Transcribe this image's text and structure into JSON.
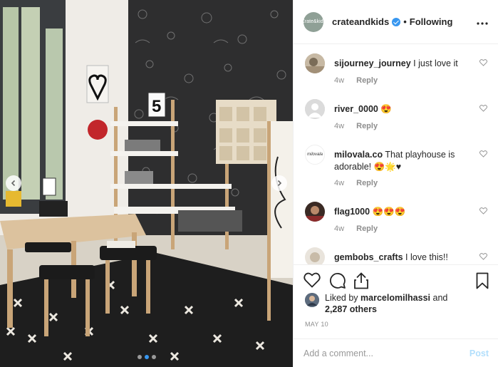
{
  "post": {
    "account": {
      "logo_text": "Crate&kids",
      "username": "crateandkids",
      "separator": "•",
      "follow_status": "Following",
      "more_icon": "more-horizontal-icon"
    },
    "comments": [
      {
        "username": "sijourney_journey",
        "text": "I just love it",
        "age": "4w",
        "reply_label": "Reply"
      },
      {
        "username": "river_0000",
        "text": "😍",
        "age": "4w",
        "reply_label": "Reply"
      },
      {
        "username": "milovala.co",
        "text": "That playhouse is adorable! 😍🌟♥",
        "age": "4w",
        "reply_label": "Reply",
        "avatar_text": "milovala"
      },
      {
        "username": "flag1000",
        "text": "😍😍😍",
        "age": "4w",
        "reply_label": "Reply"
      },
      {
        "username": "gembobs_crafts",
        "text": "I love this!! Xxxx",
        "age": "",
        "reply_label": ""
      }
    ],
    "likes": {
      "prefix": "Liked by",
      "user": "marcelomilhassi",
      "joiner": "and",
      "count": "2,287 others"
    },
    "date": "MAY 10",
    "add_comment": {
      "placeholder": "Add a comment...",
      "post_label": "Post"
    },
    "photo": {
      "card_number": "5",
      "carousel_total": 3,
      "carousel_active": 1
    },
    "colors": {
      "accent": "#3897f0",
      "post_disabled": "#b2dffc",
      "muted": "#8e8e8e"
    }
  }
}
